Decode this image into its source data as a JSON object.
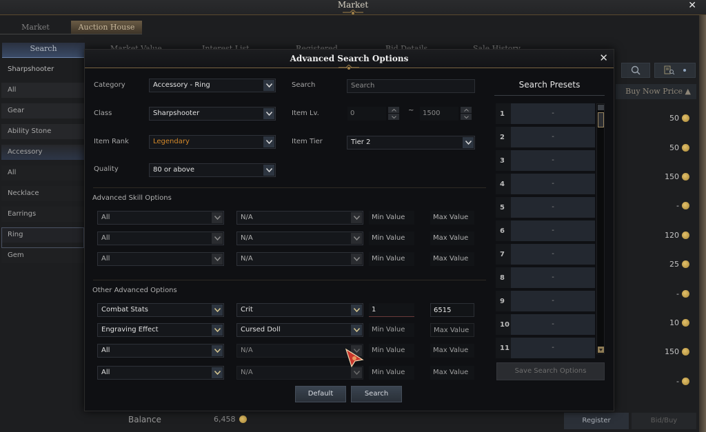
{
  "window": {
    "title": "Market",
    "close_icon": "close-icon"
  },
  "main_tabs": [
    {
      "label": "Market",
      "active": false
    },
    {
      "label": "Auction House",
      "active": true
    }
  ],
  "sub_tabs": [
    {
      "label": "Search",
      "active": true
    },
    {
      "label": "Market Value"
    },
    {
      "label": "Interest List"
    },
    {
      "label": "Registered"
    },
    {
      "label": "Bid Details"
    },
    {
      "label": "Sale History"
    }
  ],
  "sidebar": {
    "items": [
      {
        "label": "Sharpshooter",
        "type": "header"
      },
      {
        "label": "All"
      },
      {
        "label": "Gear"
      },
      {
        "label": "Ability Stone"
      },
      {
        "label": "Accessory",
        "type": "highlight"
      },
      {
        "label": "All"
      },
      {
        "label": "Necklace"
      },
      {
        "label": "Earrings"
      },
      {
        "label": "Ring",
        "selected": true
      },
      {
        "label": "Gem"
      }
    ]
  },
  "results": {
    "search_icon": "search-icon",
    "detail_search_icon": "list-search-icon",
    "column_header": "Buy Now Price ▲",
    "prices": [
      "50",
      "50",
      "150",
      "-",
      "120",
      "25",
      "-",
      "10",
      "150",
      "-"
    ]
  },
  "footer": {
    "balance_label": "Balance",
    "balance_value": "6,458",
    "register_label": "Register",
    "bidbuy_label": "Bid/Buy"
  },
  "modal": {
    "title": "Advanced Search Options",
    "fields": {
      "category_label": "Category",
      "category_value": "Accessory - Ring",
      "class_label": "Class",
      "class_value": "Sharpshooter",
      "rank_label": "Item Rank",
      "rank_value": "Legendary",
      "rank_color": "#d4892a",
      "quality_label": "Quality",
      "quality_value": "80 or above",
      "search_label": "Search",
      "search_placeholder": "Search",
      "itemlv_label": "Item Lv.",
      "itemlv_min": "0",
      "itemlv_sep": "~",
      "itemlv_max": "1500",
      "tier_label": "Item Tier",
      "tier_value": "Tier 2"
    },
    "skill_section": {
      "title": "Advanced Skill Options",
      "rows": [
        {
          "type": "All",
          "option": "N/A",
          "min": "Min Value",
          "max": "Max Value"
        },
        {
          "type": "All",
          "option": "N/A",
          "min": "Min Value",
          "max": "Max Value"
        },
        {
          "type": "All",
          "option": "N/A",
          "min": "Min Value",
          "max": "Max Value"
        }
      ]
    },
    "other_section": {
      "title": "Other Advanced Options",
      "rows": [
        {
          "type": "Combat Stats",
          "option": "Crit",
          "min": "1",
          "max": "6515"
        },
        {
          "type": "Engraving Effect",
          "option": "Cursed Doll",
          "min": "Min Value",
          "max": "Max Value"
        },
        {
          "type": "All",
          "option": "N/A",
          "min": "Min Value",
          "max": "Max Value"
        },
        {
          "type": "All",
          "option": "N/A",
          "min": "Min Value",
          "max": "Max Value"
        }
      ]
    },
    "buttons": {
      "default_label": "Default",
      "search_label": "Search"
    },
    "presets": {
      "title": "Search Presets",
      "items": [
        {
          "num": "1",
          "value": "-"
        },
        {
          "num": "2",
          "value": "-"
        },
        {
          "num": "3",
          "value": "-"
        },
        {
          "num": "4",
          "value": "-"
        },
        {
          "num": "5",
          "value": "-"
        },
        {
          "num": "6",
          "value": "-"
        },
        {
          "num": "7",
          "value": "-"
        },
        {
          "num": "8",
          "value": "-"
        },
        {
          "num": "9",
          "value": "-"
        },
        {
          "num": "10",
          "value": "-"
        },
        {
          "num": "11",
          "value": "-"
        }
      ],
      "save_label": "Save Search Options"
    }
  }
}
